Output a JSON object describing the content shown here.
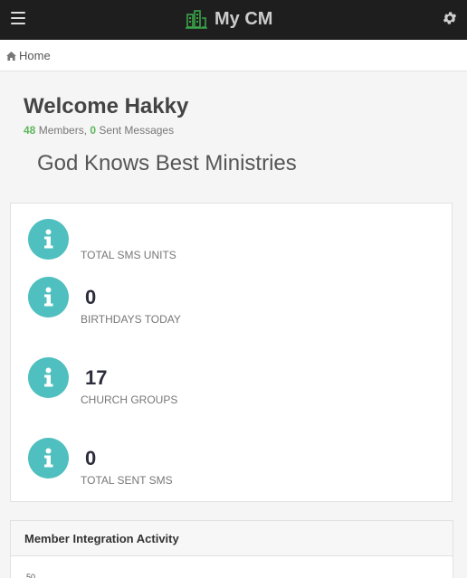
{
  "topbar": {
    "title": "My CM",
    "menu_icon": "hamburger-icon",
    "brand_icon": "building-chart-icon",
    "settings_icon": "gear-icon"
  },
  "breadcrumb": {
    "home_label": "Home"
  },
  "welcome": {
    "greeting": "Welcome Hakky",
    "members_count": "48",
    "members_label": " Members, ",
    "sent_count": "0",
    "sent_label": " Sent Messages",
    "ministry_name": "God Knows Best Ministries"
  },
  "stats": [
    {
      "value": "",
      "label": "TOTAL SMS UNITS",
      "icon": "info-icon"
    },
    {
      "value": "0",
      "label": "BIRTHDAYS TODAY",
      "icon": "info-icon"
    },
    {
      "value": "17",
      "label": "CHURCH GROUPS",
      "icon": "info-icon"
    },
    {
      "value": "0",
      "label": "TOTAL SENT SMS",
      "icon": "info-icon"
    }
  ],
  "activity": {
    "title": "Member Integration Activity",
    "first_tick": "50"
  },
  "colors": {
    "topbar_bg": "#1e1e1e",
    "info_circle": "#4fbfbf",
    "accent_green": "#5cb85c"
  }
}
